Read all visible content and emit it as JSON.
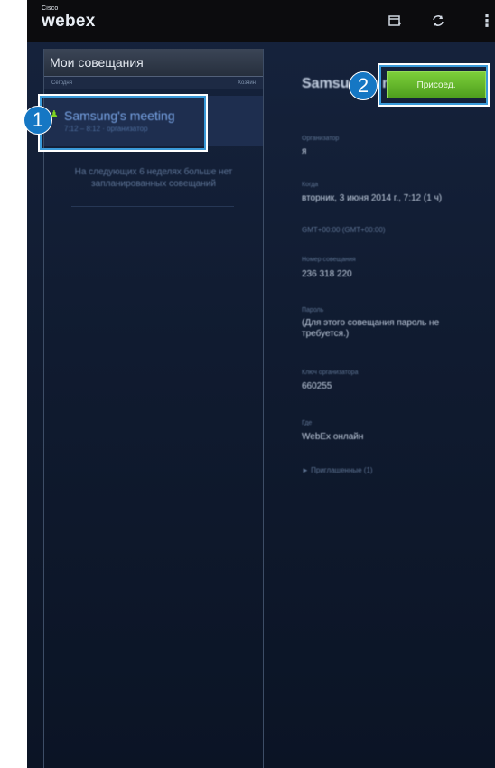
{
  "app": {
    "brand_small": "Cisco",
    "brand": "webex"
  },
  "toolbar": {
    "icons": [
      "calendar-add-icon",
      "sync-icon",
      "overflow-menu-icon"
    ]
  },
  "left_panel": {
    "title": "Мои совещания",
    "columns": [
      "Сегодня",
      "Хозяин"
    ],
    "meeting": {
      "title": "Samsung's meeting",
      "time": "7:12 – 8:12 · организатор"
    },
    "empty_message": "На следующих 6 неделях больше нет запланированных совещаний"
  },
  "detail": {
    "title": "Samsung's meeting",
    "join_button": "Присоед.",
    "fields": [
      {
        "label": "Организатор",
        "value": "я"
      },
      {
        "label": "Когда",
        "value": "вторник, 3 июня 2014 г., 7:12 (1 ч)",
        "sub": "GMT+00:00 (GMT+00:00)"
      },
      {
        "label": "Номер совещания",
        "value": "236 318 220"
      },
      {
        "label": "Пароль",
        "value": "(Для этого совещания пароль не требуется.)"
      },
      {
        "label": "Ключ организатора",
        "value": "660255"
      },
      {
        "label": "Где",
        "value": "WebEx онлайн"
      }
    ],
    "invitees": "► Приглашенные (1)"
  },
  "callouts": [
    "1",
    "2"
  ],
  "colors": {
    "accent": "#1577c4",
    "join_green": "#5bb52a",
    "background": "#101b30"
  }
}
